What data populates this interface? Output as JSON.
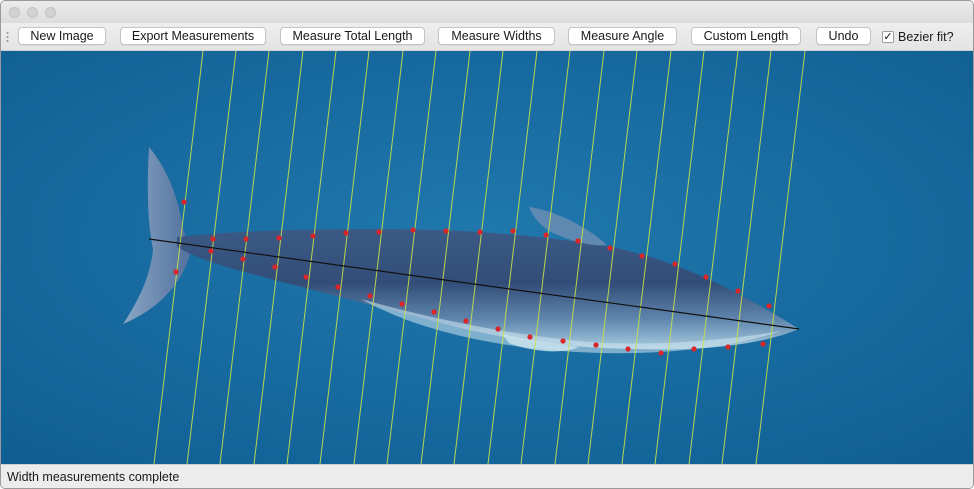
{
  "window": {
    "traffic_lights": [
      "close",
      "minimize",
      "zoom"
    ]
  },
  "toolbar": {
    "new_image": "New Image",
    "export_measurements": "Export Measurements",
    "measure_total_length": "Measure Total Length",
    "measure_widths": "Measure Widths",
    "measure_angle": "Measure Angle",
    "custom_length": "Custom Length",
    "undo": "Undo",
    "bezier_fit_label": "Bezier fit?",
    "bezier_fit_checked": true
  },
  "status": {
    "message": "Width measurements complete"
  },
  "colors": {
    "ocean": "#1f74a8",
    "measure_line": "#c8e24a",
    "marker": "#d8262a",
    "axis_line": "#111111"
  }
}
